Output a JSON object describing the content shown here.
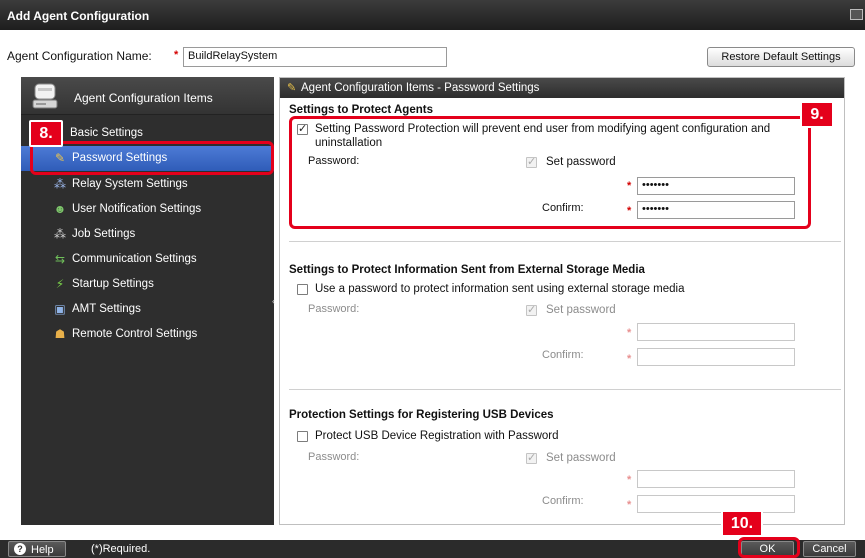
{
  "window": {
    "title": "Add Agent Configuration"
  },
  "config_name": {
    "label": "Agent Configuration Name:",
    "required_mark": "*",
    "value": "BuildRelaySystem",
    "restore_button": "Restore Default Settings"
  },
  "sidebar": {
    "header": "Agent Configuration Items",
    "items": [
      {
        "label": "Basic Settings",
        "icon": "none"
      },
      {
        "label": "Password Settings",
        "icon": "key-icon"
      },
      {
        "label": "Relay System Settings",
        "icon": "relay-icon"
      },
      {
        "label": "User Notification Settings",
        "icon": "user-notify-icon"
      },
      {
        "label": "Job Settings",
        "icon": "job-icon"
      },
      {
        "label": "Communication Settings",
        "icon": "communication-icon"
      },
      {
        "label": "Startup Settings",
        "icon": "startup-icon"
      },
      {
        "label": "AMT Settings",
        "icon": "amt-icon"
      },
      {
        "label": "Remote Control Settings",
        "icon": "remote-control-icon"
      }
    ],
    "selected_index": 1
  },
  "panel": {
    "header": "Agent Configuration Items - Password Settings",
    "protect_agents": {
      "title": "Settings to Protect Agents",
      "checkbox_label_line1": "Setting Password Protection will prevent end user from modifying agent configuration and",
      "checkbox_label_line2": "uninstallation",
      "checked": true,
      "password_label": "Password:",
      "set_password_label": "Set password",
      "password_value": "•••••••",
      "confirm_label": "Confirm:",
      "confirm_value": "•••••••",
      "required_mark": "*"
    },
    "external_media": {
      "title": "Settings to Protect Information Sent from External Storage Media",
      "checkbox_label": "Use a password to protect information sent using external storage media",
      "checked": false,
      "password_label": "Password:",
      "set_password_label": "Set password",
      "confirm_label": "Confirm:",
      "required_mark": "*"
    },
    "usb_devices": {
      "title": "Protection Settings for Registering USB Devices",
      "checkbox_label": "Protect USB Device Registration with Password",
      "checked": false,
      "password_label": "Password:",
      "set_password_label": "Set password",
      "confirm_label": "Confirm:",
      "required_mark": "*"
    }
  },
  "callouts": {
    "c8": "8.",
    "c9": "9.",
    "c10": "10."
  },
  "footer": {
    "help_button": "Help",
    "required_note": "(*)Required.",
    "ok_button": "OK",
    "cancel_button": "Cancel"
  },
  "colors": {
    "callout_red": "#e4001b",
    "selection_blue": "#2f5cb8",
    "required_red": "#d40000",
    "dark_chrome": "#2e2e2e"
  }
}
